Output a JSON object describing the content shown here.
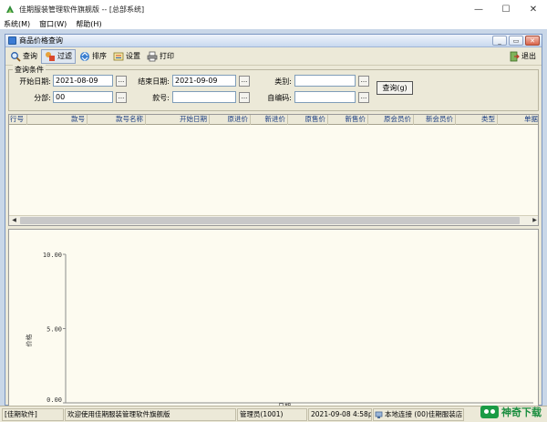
{
  "window": {
    "title": "佳期服装管理软件旗舰版 -- [总部系统]",
    "min": "—",
    "max": "☐",
    "close": "✕"
  },
  "menu": [
    "系统(M)",
    "窗口(W)",
    "帮助(H)"
  ],
  "child_window": {
    "title": "商品价格查询",
    "buttons": [
      "_",
      "▭",
      "✕"
    ]
  },
  "toolbar": {
    "items": [
      "查询",
      "过滤",
      "排序",
      "设置",
      "打印"
    ],
    "exit": "退出"
  },
  "query": {
    "caption": "查询条件",
    "start_date_label": "开始日期:",
    "start_date": "2021-08-09",
    "end_date_label": "结束日期:",
    "end_date": "2021-09-09",
    "category_label": "类别:",
    "category": "",
    "branch_label": "分部:",
    "branch": "00",
    "style_label": "款号:",
    "style": "",
    "selfcode_label": "自编码:",
    "selfcode": "",
    "query_button": "查询(g)",
    "dots": "..."
  },
  "grid": {
    "columns": [
      "行号",
      "款号",
      "款号名称",
      "开始日期",
      "原进价",
      "新进价",
      "原售价",
      "新售价",
      "原会员价",
      "新会员价",
      "类型",
      "单据"
    ]
  },
  "chart_data": {
    "type": "bar",
    "categories": [],
    "series": [],
    "ylabel": "价格",
    "xlabel": "日期",
    "y_ticks": [
      "10.00",
      "5.00",
      "0.00"
    ],
    "ylim": [
      0,
      10
    ]
  },
  "status": {
    "app": "[佳期软件]",
    "welcome": "欢迎使用佳期服装管理软件旗舰版",
    "operator": "管理员(1001)",
    "datetime": "2021-09-08 4:58pm",
    "connection": "本地连接 (00)佳期服装店"
  },
  "watermark": {
    "text": "神奇下载"
  },
  "colors": {
    "mdi_background": "#c9d7e8",
    "header_text": "#1a3d82",
    "grid_body": "#fdfbf0"
  }
}
